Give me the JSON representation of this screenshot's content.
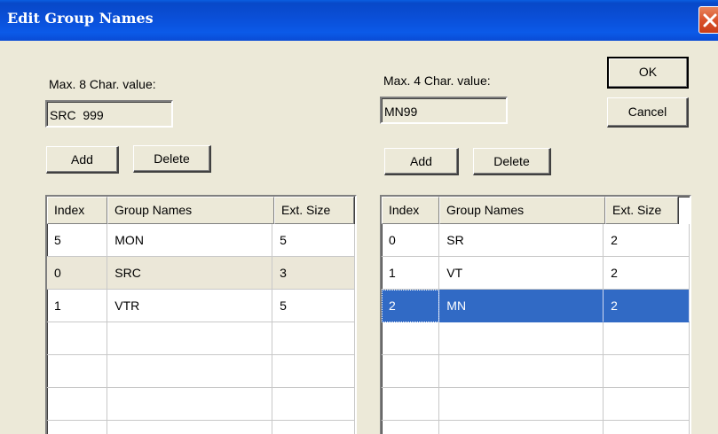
{
  "window": {
    "title": "Edit Group Names"
  },
  "left": {
    "label": "Max. 8 Char. value:",
    "input_value": "SRC  999",
    "add_label": "Add",
    "delete_label": "Delete",
    "columns": [
      "Index",
      "Group Names",
      "Ext. Size"
    ],
    "rows": [
      {
        "index": "5",
        "name": "MON",
        "size": "5"
      },
      {
        "index": "0",
        "name": "SRC",
        "size": "3"
      },
      {
        "index": "1",
        "name": "VTR",
        "size": "5"
      }
    ]
  },
  "right": {
    "label": "Max. 4 Char. value:",
    "input_value": "MN99",
    "add_label": "Add",
    "delete_label": "Delete",
    "columns": [
      "Index",
      "Group Names",
      "Ext. Size"
    ],
    "rows": [
      {
        "index": "0",
        "name": "SR",
        "size": "2"
      },
      {
        "index": "1",
        "name": "VT",
        "size": "2"
      },
      {
        "index": "2",
        "name": "MN",
        "size": "2"
      }
    ],
    "selected_row": 2
  },
  "buttons": {
    "ok_label": "OK",
    "cancel_label": "Cancel"
  },
  "colors": {
    "titlebar": "#0a4fd8",
    "selection": "#316ac5",
    "face": "#ece9d8"
  }
}
